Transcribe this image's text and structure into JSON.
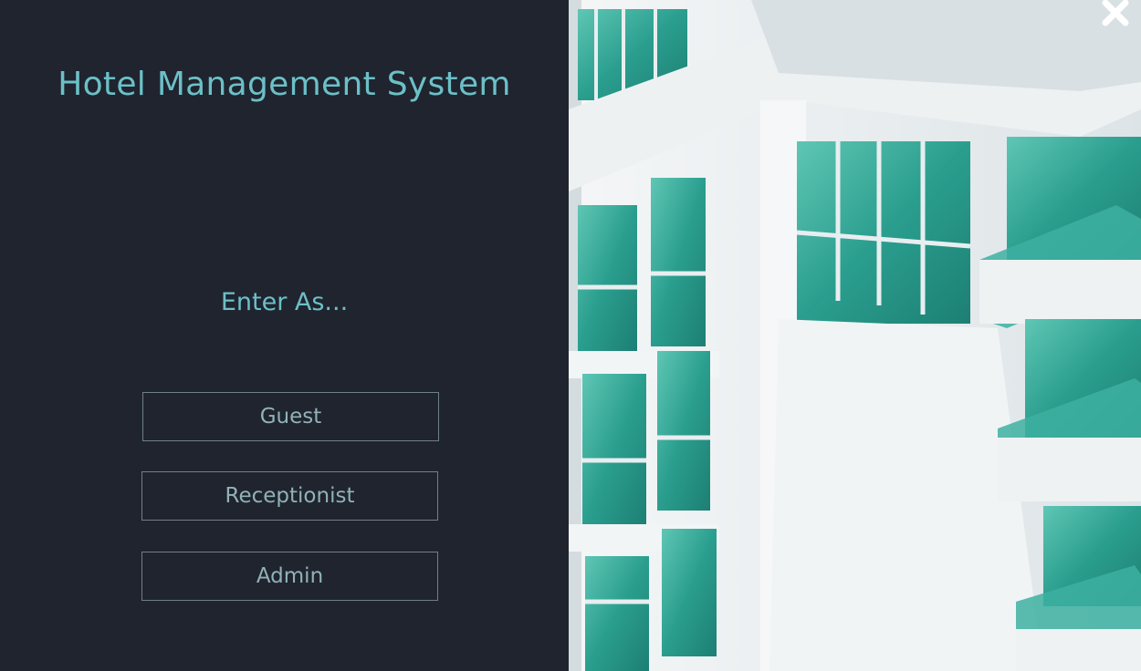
{
  "window": {
    "title": "Hotel Management System"
  },
  "login": {
    "prompt": "Enter As...",
    "roles": [
      {
        "label": "Guest"
      },
      {
        "label": "Receptionist"
      },
      {
        "label": "Admin"
      }
    ]
  },
  "icons": {
    "close": "close-icon"
  },
  "colors": {
    "background": "#20242e",
    "accent": "#6cc0c8",
    "button_text": "#8fb2b8",
    "button_border": "#6f8088",
    "glass": "#2fa79a"
  }
}
